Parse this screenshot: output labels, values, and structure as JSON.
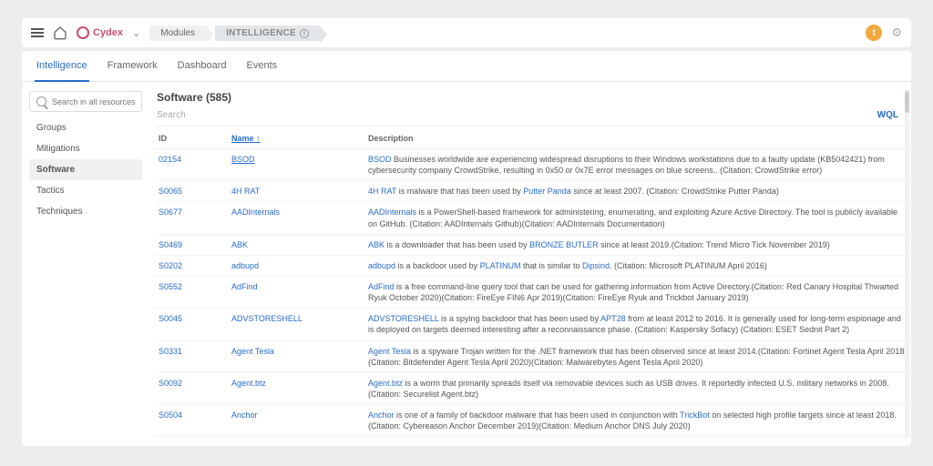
{
  "topbar": {
    "brand": "Cydex",
    "crumb_modules": "Modules",
    "crumb_intel": "INTELLIGENCE",
    "avatar_initial": "t"
  },
  "tabs": [
    "Intelligence",
    "Framework",
    "Dashboard",
    "Events"
  ],
  "active_tab": 0,
  "search_placeholder": "Search in all resources",
  "side_items": [
    "Groups",
    "Mitigations",
    "Software",
    "Tactics",
    "Techniques"
  ],
  "side_selected": 2,
  "main": {
    "title": "Software (585)",
    "filter_placeholder": "Search",
    "wql_label": "WQL",
    "cols": {
      "id": "ID",
      "name": "Name",
      "desc": "Description"
    }
  },
  "rows": [
    {
      "id": "02154",
      "name": "BSOD",
      "underline": true,
      "desc_parts": [
        {
          "l": "BSOD"
        },
        {
          "t": " Businesses worldwide are experiencing widespread disruptions to their Windows workstations due to a faulty update (KB5042421) from cybersecurity company CrowdStrike, resulting in 0x50 or 0x7E error messages on blue screens.. (Citation: CrowdStrike error)"
        }
      ]
    },
    {
      "id": "S0065",
      "name": "4H RAT",
      "desc_parts": [
        {
          "l": "4H RAT"
        },
        {
          "t": " is malware that has been used by "
        },
        {
          "l": "Putter Panda"
        },
        {
          "t": " since at least 2007. (Citation: CrowdStrike Putter Panda)"
        }
      ]
    },
    {
      "id": "S0677",
      "name": "AADInternals",
      "desc_parts": [
        {
          "l": "AADInternals"
        },
        {
          "t": " is a PowerShell-based framework for administering, enumerating, and exploiting Azure Active Directory. The tool is publicly available on GitHub. (Citation: AADInternals Github)(Citation: AADInternals Documentation)"
        }
      ]
    },
    {
      "id": "S0469",
      "name": "ABK",
      "desc_parts": [
        {
          "l": "ABK"
        },
        {
          "t": " is a downloader that has been used by "
        },
        {
          "l": "BRONZE BUTLER"
        },
        {
          "t": " since at least 2019.(Citation: Trend Micro Tick November 2019)"
        }
      ]
    },
    {
      "id": "S0202",
      "name": "adbupd",
      "desc_parts": [
        {
          "l": "adbupd"
        },
        {
          "t": " is a backdoor used by "
        },
        {
          "l": "PLATINUM"
        },
        {
          "t": " that is similar to "
        },
        {
          "l": "Dipsind"
        },
        {
          "t": ". (Citation: Microsoft PLATINUM April 2016)"
        }
      ]
    },
    {
      "id": "S0552",
      "name": "AdFind",
      "desc_parts": [
        {
          "l": "AdFind"
        },
        {
          "t": " is a free command-line query tool that can be used for gathering information from Active Directory.(Citation: Red Canary Hospital Thwarted Ryuk October 2020)(Citation: FireEye FIN6 Apr 2019)(Citation: FireEye Ryuk and Trickbot January 2019)"
        }
      ]
    },
    {
      "id": "S0045",
      "name": "ADVSTORESHELL",
      "desc_parts": [
        {
          "l": "ADVSTORESHELL"
        },
        {
          "t": " is a spying backdoor that has been used by "
        },
        {
          "l": "APT28"
        },
        {
          "t": " from at least 2012 to 2016. It is generally used for long-term espionage and is deployed on targets deemed interesting after a reconnaissance phase. (Citation: Kaspersky Sofacy) (Citation: ESET Sednit Part 2)"
        }
      ]
    },
    {
      "id": "S0331",
      "name": "Agent Tesla",
      "desc_parts": [
        {
          "l": "Agent Tesla"
        },
        {
          "t": " is a spyware Trojan written for the .NET framework that has been observed since at least 2014.(Citation: Fortinet Agent Tesla April 2018)(Citation: Bitdefender Agent Tesla April 2020)(Citation: Malwarebytes Agent Tesla April 2020)"
        }
      ]
    },
    {
      "id": "S0092",
      "name": "Agent.btz",
      "desc_parts": [
        {
          "l": "Agent.btz"
        },
        {
          "t": " is a worm that primarily spreads itself via removable devices such as USB drives. It reportedly infected U.S. military networks in 2008. (Citation: Securelist Agent.btz)"
        }
      ]
    },
    {
      "id": "S0504",
      "name": "Anchor",
      "desc_parts": [
        {
          "l": "Anchor"
        },
        {
          "t": " is one of a family of backdoor malware that has been used in conjunction with "
        },
        {
          "l": "TrickBot"
        },
        {
          "t": " on selected high profile targets since at least 2018.(Citation: Cybereason Anchor December 2019)(Citation: Medium Anchor DNS July 2020)"
        }
      ]
    }
  ]
}
